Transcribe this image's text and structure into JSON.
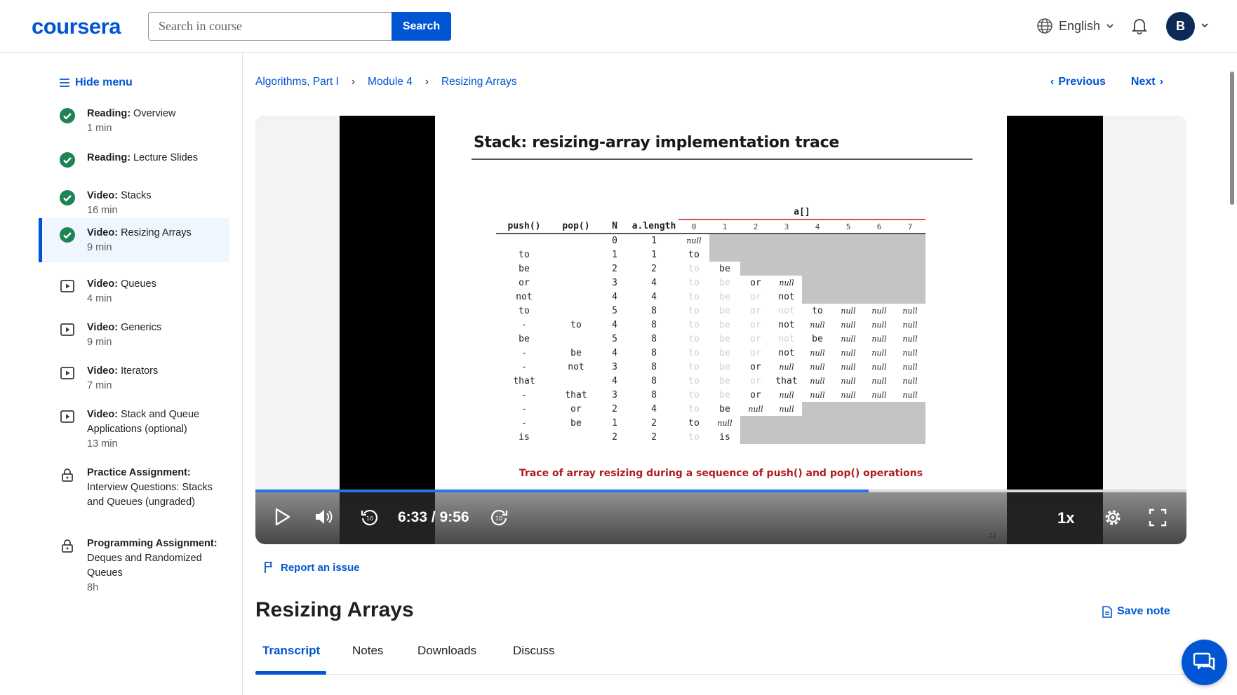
{
  "header": {
    "logo": "coursera",
    "search_placeholder": "Search in course",
    "search_button": "Search",
    "language": "English",
    "avatar_initial": "B"
  },
  "sidebar": {
    "hide_menu": "Hide menu",
    "items": [
      {
        "type": "Reading:",
        "title": "Overview",
        "duration": "1 min",
        "status": "completed"
      },
      {
        "type": "Reading:",
        "title": "Lecture Slides",
        "duration": "",
        "status": "completed"
      },
      {
        "type": "Video:",
        "title": "Stacks",
        "duration": "16 min",
        "status": "completed"
      },
      {
        "type": "Video:",
        "title": "Resizing Arrays",
        "duration": "9 min",
        "status": "completed-active"
      },
      {
        "type": "Video:",
        "title": "Queues",
        "duration": "4 min",
        "status": "video"
      },
      {
        "type": "Video:",
        "title": "Generics",
        "duration": "9 min",
        "status": "video"
      },
      {
        "type": "Video:",
        "title": "Iterators",
        "duration": "7 min",
        "status": "video"
      },
      {
        "type": "Video:",
        "title": "Stack and Queue Applications (optional)",
        "duration": "13 min",
        "status": "video"
      },
      {
        "type": "Practice Assignment:",
        "title": "Interview Questions: Stacks and Queues (ungraded)",
        "duration": "",
        "status": "locked"
      },
      {
        "type": "Programming Assignment:",
        "title": "Deques and Randomized Queues",
        "duration": "8h",
        "status": "locked"
      }
    ]
  },
  "breadcrumb": [
    "Algorithms, Part I",
    "Module 4",
    "Resizing Arrays"
  ],
  "nav": {
    "previous": "Previous",
    "next": "Next"
  },
  "video": {
    "slide_title": "Stack:  resizing-array implementation trace",
    "caption": "Trace of array resizing during a sequence of push() and pop() operations",
    "slide_number": "22",
    "time": "6:33 / 9:56",
    "progress": 0.659,
    "speed": "1x",
    "table": {
      "headers": [
        "push()",
        "pop()",
        "N",
        "a.length"
      ],
      "array_label": "a[]",
      "indices": [
        "0",
        "1",
        "2",
        "3",
        "4",
        "5",
        "6",
        "7"
      ],
      "rows": [
        {
          "push": "",
          "pop": "",
          "n": "0",
          "len": "1",
          "cells": [
            "null"
          ]
        },
        {
          "push": "to",
          "pop": "",
          "n": "1",
          "len": "1",
          "cells": [
            "to"
          ]
        },
        {
          "push": "be",
          "pop": "",
          "n": "2",
          "len": "2",
          "cells": [
            "to",
            "be"
          ]
        },
        {
          "push": "or",
          "pop": "",
          "n": "3",
          "len": "4",
          "cells": [
            "to",
            "be",
            "or",
            "null"
          ]
        },
        {
          "push": "not",
          "pop": "",
          "n": "4",
          "len": "4",
          "cells": [
            "to",
            "be",
            "or",
            "not"
          ]
        },
        {
          "push": "to",
          "pop": "",
          "n": "5",
          "len": "8",
          "cells": [
            "to",
            "be",
            "or",
            "not",
            "to",
            "null",
            "null",
            "null"
          ]
        },
        {
          "push": "-",
          "pop": "to",
          "n": "4",
          "len": "8",
          "cells": [
            "to",
            "be",
            "or",
            "not",
            "null",
            "null",
            "null",
            "null"
          ]
        },
        {
          "push": "be",
          "pop": "",
          "n": "5",
          "len": "8",
          "cells": [
            "to",
            "be",
            "or",
            "not",
            "be",
            "null",
            "null",
            "null"
          ]
        },
        {
          "push": "-",
          "pop": "be",
          "n": "4",
          "len": "8",
          "cells": [
            "to",
            "be",
            "or",
            "not",
            "null",
            "null",
            "null",
            "null"
          ]
        },
        {
          "push": "-",
          "pop": "not",
          "n": "3",
          "len": "8",
          "cells": [
            "to",
            "be",
            "or",
            "null",
            "null",
            "null",
            "null",
            "null"
          ]
        },
        {
          "push": "that",
          "pop": "",
          "n": "4",
          "len": "8",
          "cells": [
            "to",
            "be",
            "or",
            "that",
            "null",
            "null",
            "null",
            "null"
          ]
        },
        {
          "push": "-",
          "pop": "that",
          "n": "3",
          "len": "8",
          "cells": [
            "to",
            "be",
            "or",
            "null",
            "null",
            "null",
            "null",
            "null"
          ]
        },
        {
          "push": "-",
          "pop": "or",
          "n": "2",
          "len": "4",
          "cells": [
            "to",
            "be",
            "null",
            "null"
          ]
        },
        {
          "push": "-",
          "pop": "be",
          "n": "1",
          "len": "2",
          "cells": [
            "to",
            "null"
          ]
        },
        {
          "push": "is",
          "pop": "",
          "n": "2",
          "len": "2",
          "cells": [
            "to",
            "is"
          ]
        }
      ]
    }
  },
  "report_issue": "Report an issue",
  "page_title": "Resizing Arrays",
  "save_note": "Save note",
  "tabs": [
    "Transcript",
    "Notes",
    "Downloads",
    "Discuss"
  ],
  "colors": {
    "brand": "#0056d2",
    "completed": "#1f8354",
    "avatar": "#0b2a56"
  }
}
